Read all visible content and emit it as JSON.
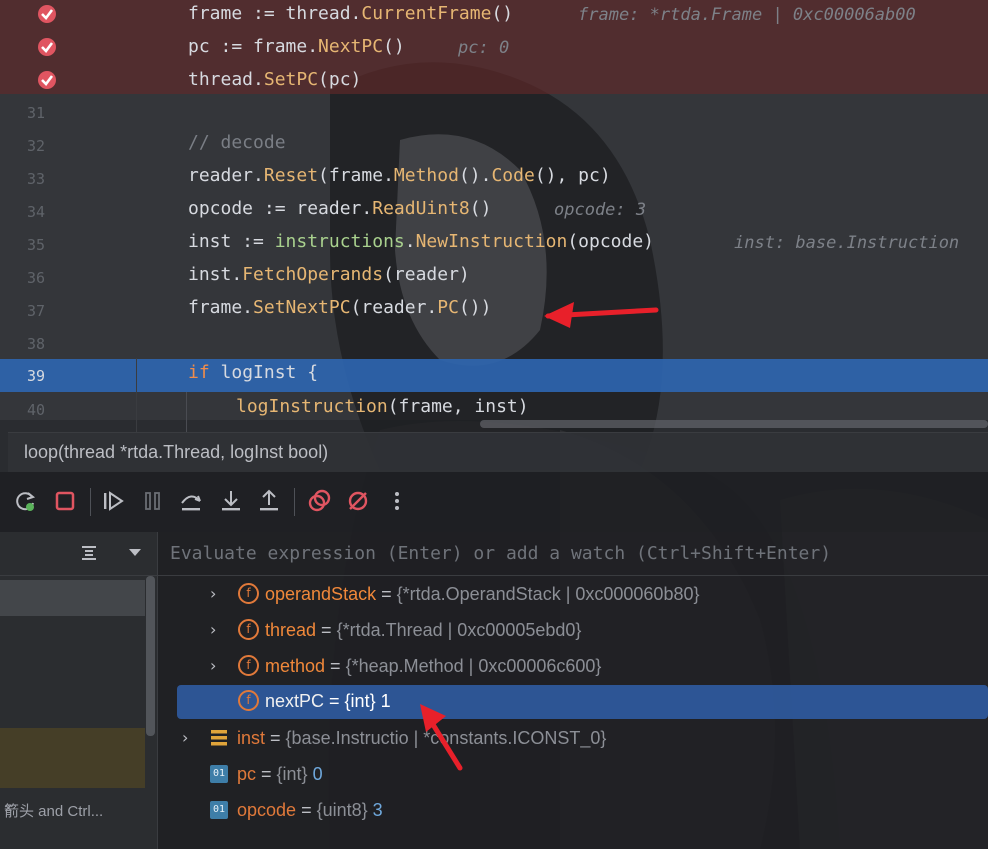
{
  "editor": {
    "lines": [
      {
        "num": "",
        "breakpoint": true
      },
      {
        "num": "",
        "breakpoint": true
      },
      {
        "num": "",
        "breakpoint": true
      },
      {
        "num": "31"
      },
      {
        "num": "32"
      },
      {
        "num": "33"
      },
      {
        "num": "34"
      },
      {
        "num": "35"
      },
      {
        "num": "36"
      },
      {
        "num": "37"
      },
      {
        "num": "38"
      },
      {
        "num": "39"
      },
      {
        "num": "40"
      }
    ],
    "hints": {
      "frame": "frame: *rtda.Frame | 0xc00006ab00",
      "pc": "pc: 0",
      "opcode": "opcode: 3",
      "inst": "inst: base.Instruction"
    }
  },
  "breadcrumb": "loop(thread *rtda.Thread, logInst bool)",
  "toolbar": {
    "icons": [
      "rerun-icon",
      "stop-icon",
      "resume-icon",
      "pause-icon",
      "step-over-icon",
      "step-into-icon",
      "step-out-icon",
      "view-breakpoints-icon",
      "mute-breakpoints-icon",
      "more-icon"
    ]
  },
  "frames_panel": {
    "hint_text": "箭头 and Ctrl...",
    "close": "×"
  },
  "variables": {
    "watch_placeholder": "Evaluate expression (Enter) or add a watch (Ctrl+Shift+Enter)",
    "rows": [
      {
        "name": "operandStack",
        "eq": " = ",
        "type": "{*rtda.OperandStack | 0xc000060b80}",
        "value": ""
      },
      {
        "name": "thread",
        "eq": " = ",
        "type": "{*rtda.Thread | 0xc00005ebd0}",
        "value": ""
      },
      {
        "name": "method",
        "eq": " = ",
        "type": "{*heap.Method | 0xc00006c600}",
        "value": ""
      },
      {
        "name": "nextPC",
        "eq": " = ",
        "type": "{int}",
        "value": " 1"
      },
      {
        "name": "inst",
        "eq": " = ",
        "type": "{base.Instructio",
        "value": " | *constants.ICONST_0}"
      },
      {
        "name": "pc",
        "eq": " = ",
        "type": "{int}",
        "value": " 0"
      },
      {
        "name": "opcode",
        "eq": " = ",
        "type": "{uint8}",
        "value": " 3"
      }
    ],
    "badges": {
      "field": "f",
      "value": "01"
    }
  }
}
